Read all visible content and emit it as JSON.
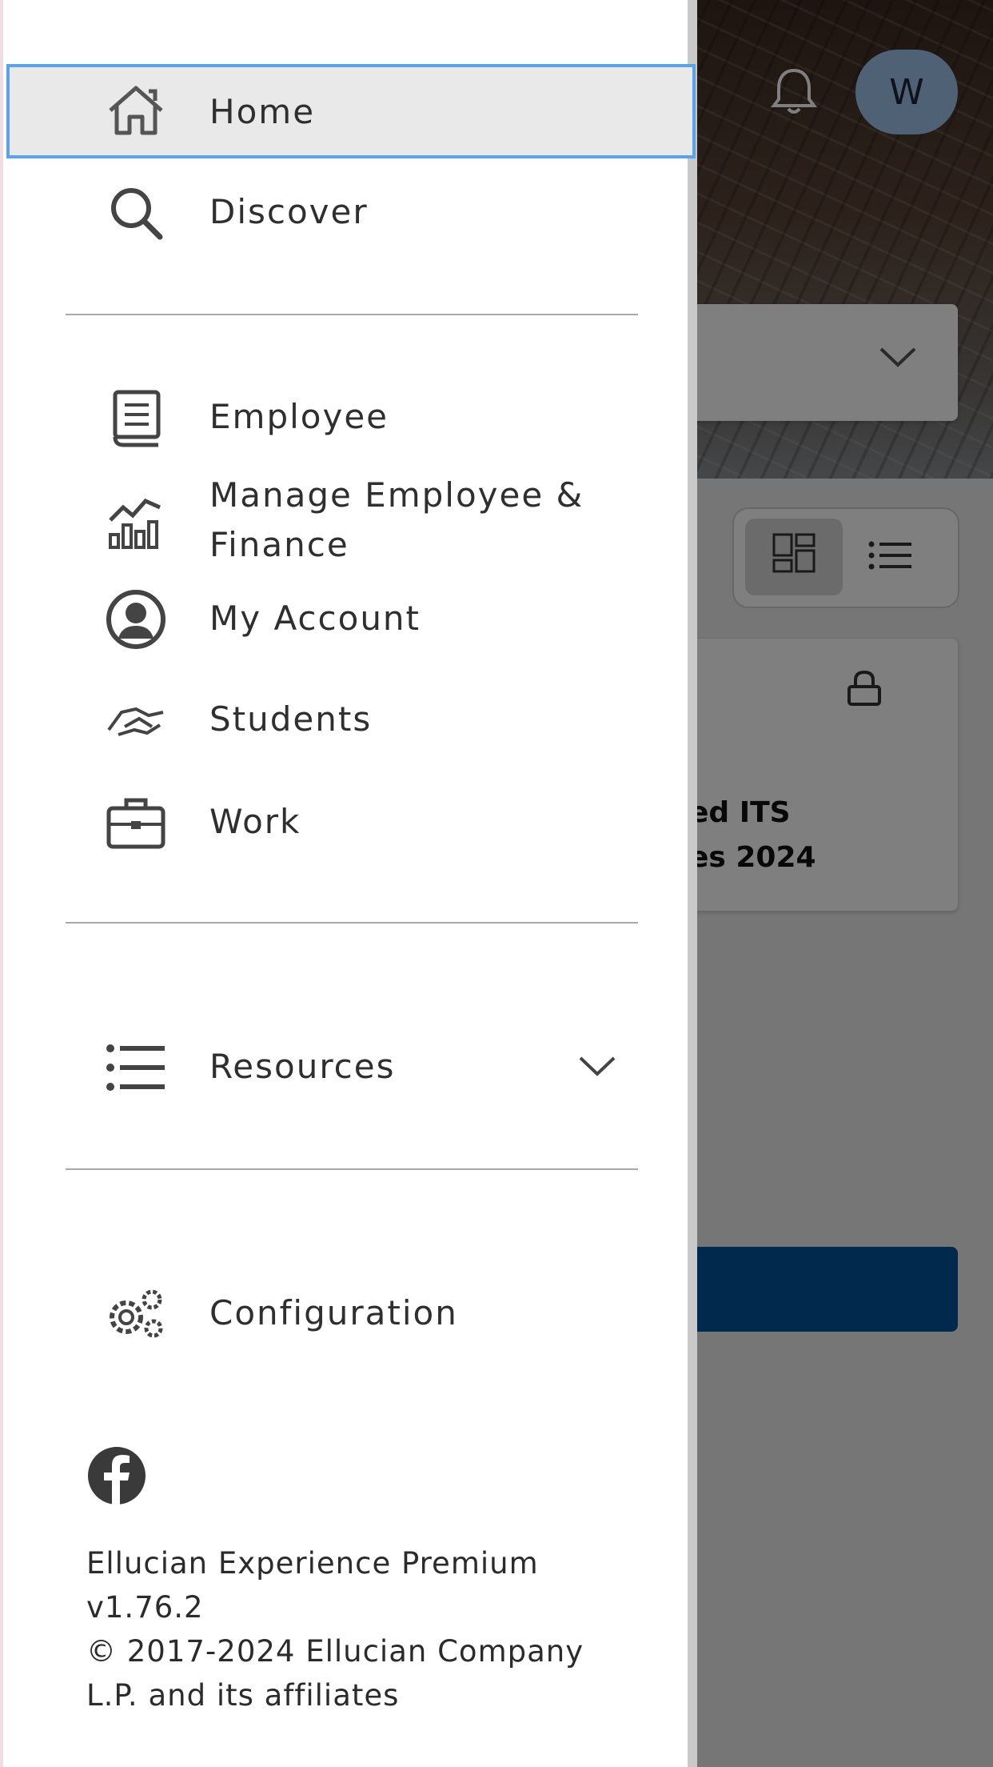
{
  "header": {
    "avatar_initial": "W"
  },
  "card": {
    "title_line1": "ed ITS",
    "title_line2": "es 2024"
  },
  "nav": {
    "primary": [
      {
        "label": "Home",
        "icon": "home-icon",
        "selected": true
      },
      {
        "label": "Discover",
        "icon": "search-icon"
      }
    ],
    "apps": [
      {
        "label": "Employee",
        "icon": "book-icon"
      },
      {
        "label_line1": "Manage Employee &",
        "label_line2": "Finance",
        "icon": "chart-icon"
      },
      {
        "label": "My Account",
        "icon": "user-circle-icon"
      },
      {
        "label": "Students",
        "icon": "handshake-icon"
      },
      {
        "label": "Work",
        "icon": "briefcase-icon"
      }
    ],
    "resources": {
      "label": "Resources",
      "icon": "list-icon",
      "expanded": false
    },
    "configuration": {
      "label": "Configuration",
      "icon": "gears-icon"
    }
  },
  "footer": {
    "social": "facebook-icon",
    "product": "Ellucian Experience Premium",
    "version": "v1.76.2",
    "copyright_line1": "© 2017-2024 Ellucian Company",
    "copyright_line2": "L.P. and its affiliates"
  },
  "colors": {
    "selected_border": "#5aa3ea",
    "primary_button": "#00529b",
    "avatar": "#9fc3e8"
  }
}
